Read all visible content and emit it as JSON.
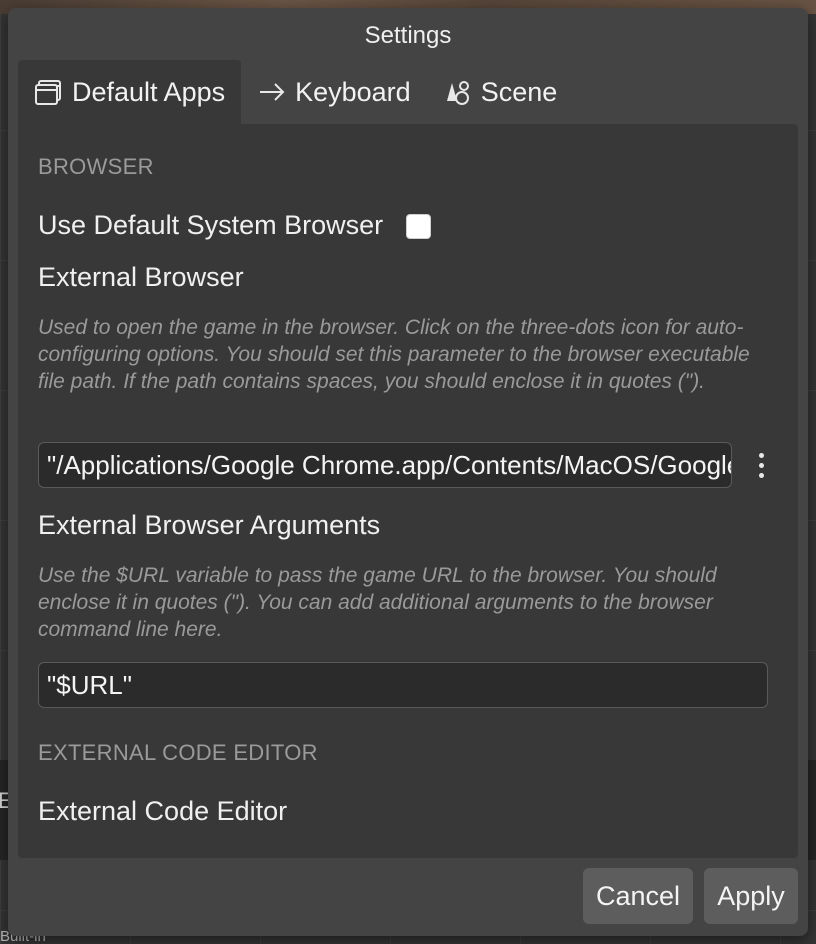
{
  "background": {
    "letter": "E",
    "builtin_text": "Built-in"
  },
  "dialog": {
    "title": "Settings",
    "tabs": [
      {
        "label": "Default Apps",
        "icon": "window-icon",
        "active": true
      },
      {
        "label": "Keyboard",
        "icon": "arrow-right-icon",
        "active": false
      },
      {
        "label": "Scene",
        "icon": "scene-icon",
        "active": false
      }
    ],
    "browser": {
      "section_title": "BROWSER",
      "use_default_label": "Use Default System Browser",
      "use_default_checked": false,
      "external_label": "External Browser",
      "external_help": "Used to open the game in the browser. Click on the three-dots icon for auto-configuring options. You should set this parameter to the browser executable file path. If the path contains spaces, you should enclose it in quotes (\").",
      "external_value": "\"/Applications/Google Chrome.app/Contents/MacOS/Google Chrome\"",
      "arguments_label": "External Browser Arguments",
      "arguments_help": "Use the $URL variable to pass the game URL to the browser. You should enclose it in quotes (\"). You can add additional arguments to the browser command line here.",
      "arguments_value": "\"$URL\""
    },
    "code_editor": {
      "section_title": "EXTERNAL CODE EDITOR",
      "label": "External Code Editor"
    },
    "buttons": {
      "cancel": "Cancel",
      "apply": "Apply"
    }
  }
}
